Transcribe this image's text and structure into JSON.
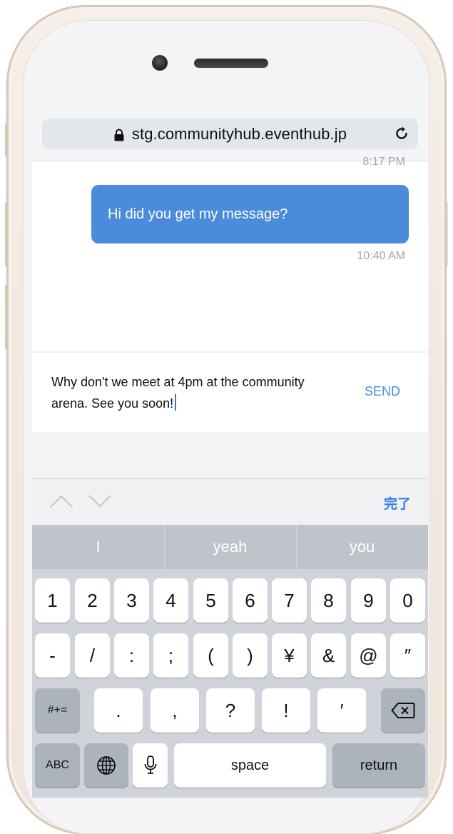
{
  "browser": {
    "url": "stg.communityhub.eventhub.jp",
    "lock_icon": "lock-icon",
    "reload_icon": "reload-icon"
  },
  "chat": {
    "timestamp_top": "8:17 PM",
    "bubble_text": "Hi did you get my message?",
    "timestamp_bottom": "10:40 AM"
  },
  "composer": {
    "input_value": "Why don't we meet at 4pm at the community arena. See you soon!",
    "send_label": "SEND"
  },
  "accessory_bar": {
    "prev_icon": "chevron-up-icon",
    "next_icon": "chevron-down-icon",
    "done_label": "完了"
  },
  "keyboard": {
    "suggestions": [
      "I",
      "yeah",
      "you"
    ],
    "row1": [
      "1",
      "2",
      "3",
      "4",
      "5",
      "6",
      "7",
      "8",
      "9",
      "0"
    ],
    "row2": [
      "-",
      "/",
      ":",
      ";",
      "(",
      ")",
      "¥",
      "&",
      "@",
      "″"
    ],
    "row3_left": "#+=",
    "row3": [
      ".",
      ",",
      "?",
      "!",
      "′"
    ],
    "row3_right_icon": "backspace-icon",
    "row4_left": "ABC",
    "row4_globe_icon": "globe-icon",
    "row4_mic_icon": "microphone-icon",
    "row4_space": "space",
    "row4_return": "return"
  },
  "colors": {
    "bubble": "#4a8cd9",
    "send": "#4a8cd9",
    "done": "#2f7cf6"
  }
}
